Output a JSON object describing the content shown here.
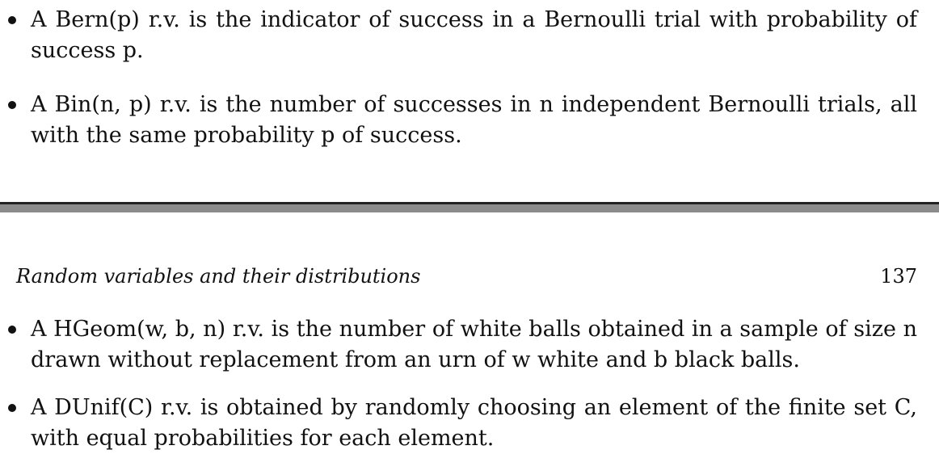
{
  "top_page": {
    "items": [
      {
        "line1": "A Bern(p) r.v. is the indicator of success in a Bernoulli trial with probability of",
        "line2": "success p."
      },
      {
        "line1": "A Bin(n, p) r.v. is the number of successes in n independent Bernoulli trials, all",
        "line2": "with the same probability p of success."
      }
    ]
  },
  "bottom_page": {
    "running_head": "Random variables and their distributions",
    "page_number": "137",
    "items": [
      {
        "line1": "A HGeom(w, b, n) r.v. is the number of white balls obtained in a sample of size n",
        "line2": "drawn without replacement from an urn of w white and b black balls."
      },
      {
        "line1": "A DUnif(C) r.v. is obtained by randomly choosing an element of the finite set C,",
        "line2": "with equal probabilities for each element."
      }
    ]
  }
}
